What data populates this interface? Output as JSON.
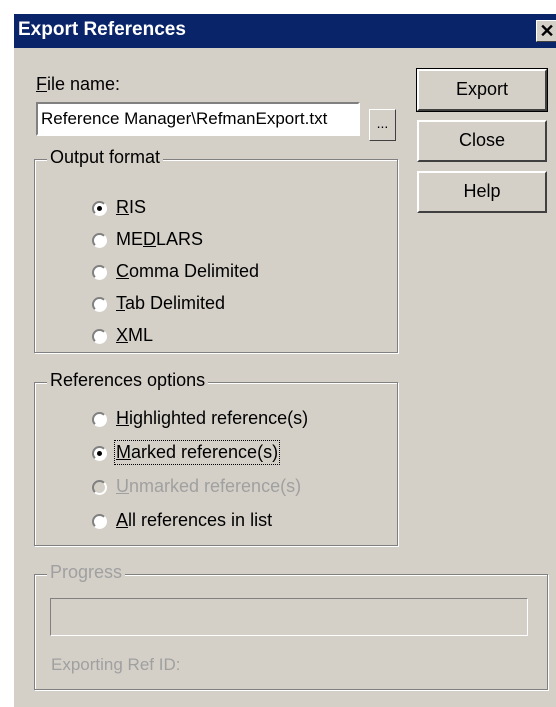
{
  "window": {
    "title": "Export References",
    "close_glyph": "✕"
  },
  "file": {
    "label_first": "F",
    "label_rest": "ile name:",
    "value": "Reference Manager\\RefmanExport.txt",
    "browse_label": "..."
  },
  "buttons": {
    "export": "Export",
    "close": "Close",
    "help": "Help"
  },
  "output_format": {
    "title": "Output format",
    "options": [
      {
        "pre": "",
        "key": "R",
        "post": "IS",
        "checked": true
      },
      {
        "pre": "ME",
        "key": "D",
        "post": "LARS",
        "checked": false
      },
      {
        "pre": "",
        "key": "C",
        "post": "omma Delimited",
        "checked": false
      },
      {
        "pre": "",
        "key": "T",
        "post": "ab Delimited",
        "checked": false
      },
      {
        "pre": "",
        "key": "X",
        "post": "ML",
        "checked": false
      }
    ]
  },
  "references_options": {
    "title": "References options",
    "options": [
      {
        "pre": "",
        "key": "H",
        "post": "ighlighted reference(s)",
        "checked": false,
        "disabled": false
      },
      {
        "pre": "",
        "key": "M",
        "post": "arked reference(s)",
        "checked": true,
        "disabled": false
      },
      {
        "pre": "",
        "key": "U",
        "post": "nmarked reference(s)",
        "checked": false,
        "disabled": true
      },
      {
        "pre": "",
        "key": "A",
        "post": "ll references in list",
        "checked": false,
        "disabled": false
      }
    ]
  },
  "progress": {
    "title": "Progress",
    "status_label": "Exporting Ref ID:",
    "value": 0
  }
}
